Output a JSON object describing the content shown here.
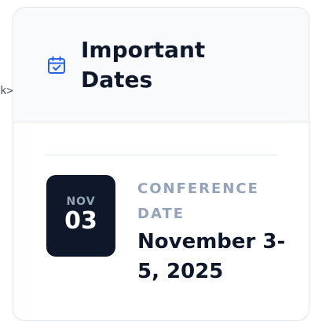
{
  "stray_text": "k>",
  "card": {
    "title": "Important Dates",
    "icon": "calendar-check-icon",
    "accent_color": "#2563eb",
    "event": {
      "month": "NOV",
      "day": "03",
      "label": "CONFERENCE DATE",
      "value": "November 3-5, 2025"
    }
  }
}
